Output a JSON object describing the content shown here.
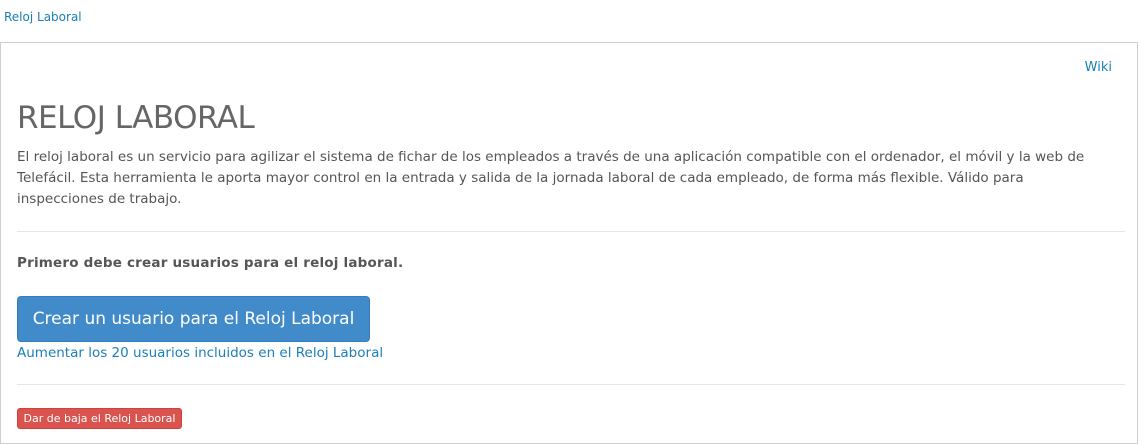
{
  "breadcrumb": {
    "label": "Reloj Laboral"
  },
  "panel": {
    "wiki_label": "Wiki",
    "title": "RELOJ LABORAL",
    "description": "El reloj laboral es un servicio para agilizar el sistema de fichar de los empleados a través de una aplicación compatible con el ordenador, el móvil y la web de Telefácil. Esta herramienta le aporta mayor control en la entrada y salida de la jornada laboral de cada empleado, de forma más flexible. Válido para inspecciones de trabajo.",
    "notice": "Primero debe crear usuarios para el reloj laboral.",
    "create_button_label": "Crear un usuario para el Reloj Laboral",
    "increase_link_label": "Aumentar los 20 usuarios incluidos en el Reloj Laboral",
    "cancel_button_label": "Dar de baja el Reloj Laboral"
  },
  "colors": {
    "link": "#1a7fb9",
    "primary": "#428bca",
    "danger": "#d9534f",
    "text": "#555555"
  }
}
